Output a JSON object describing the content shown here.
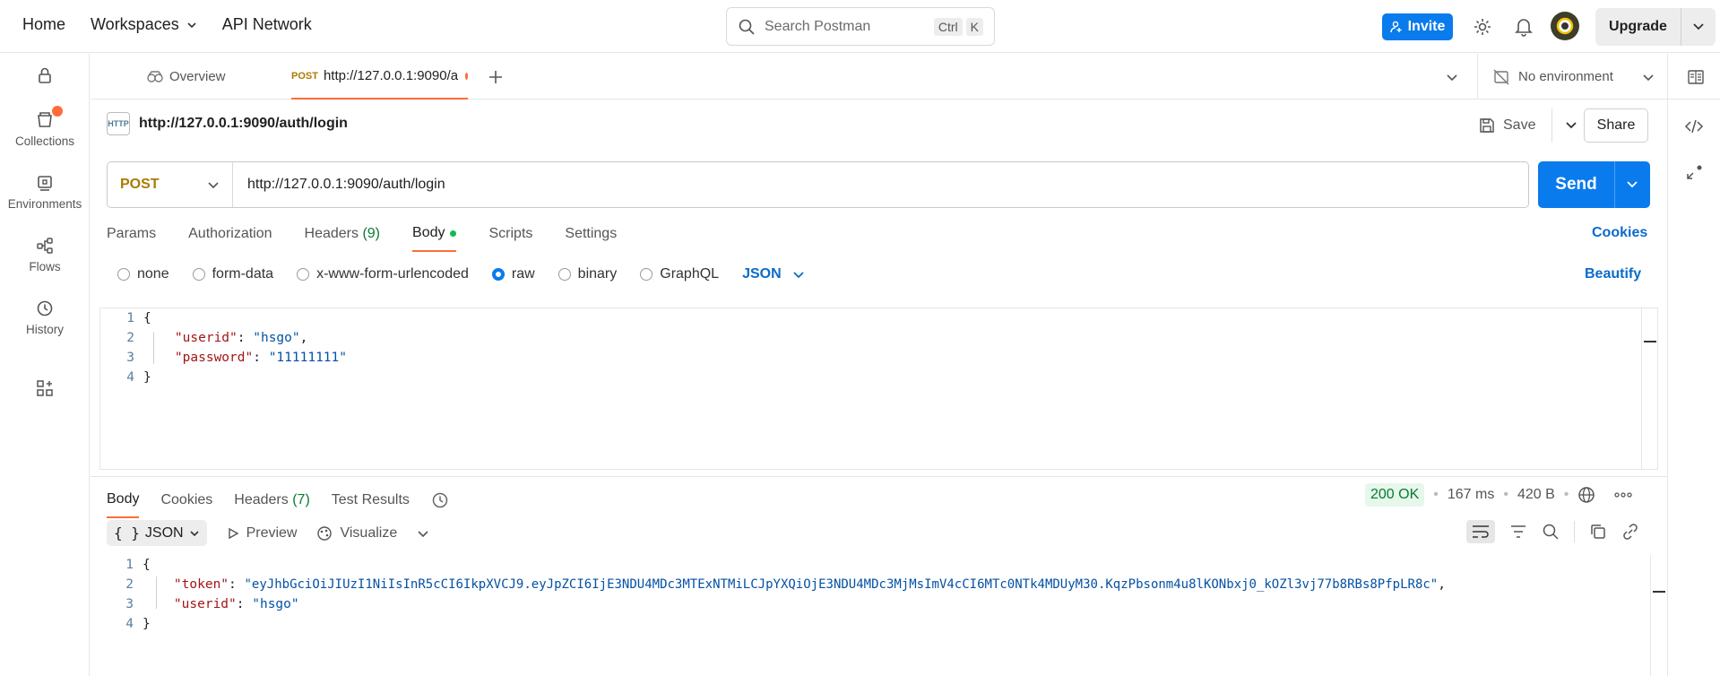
{
  "topbar": {
    "home": "Home",
    "workspaces": "Workspaces",
    "api_network": "API Network",
    "search_placeholder": "Search Postman",
    "kbd_ctrl": "Ctrl",
    "kbd_k": "K",
    "invite": "Invite",
    "upgrade": "Upgrade"
  },
  "sidebar": {
    "items": [
      {
        "label": "Collections",
        "icon": "collections-icon"
      },
      {
        "label": "Environments",
        "icon": "environments-icon"
      },
      {
        "label": "Flows",
        "icon": "flows-icon"
      },
      {
        "label": "History",
        "icon": "history-icon"
      }
    ]
  },
  "tabs": {
    "overview": "Overview",
    "active_method": "POST",
    "active_url": "http://127.0.0.1:9090/a",
    "environment": "No environment"
  },
  "request": {
    "title": "http://127.0.0.1:9090/auth/login",
    "save": "Save",
    "share": "Share",
    "method": "POST",
    "url": "http://127.0.0.1:9090/auth/login",
    "send": "Send",
    "tabs": {
      "params": "Params",
      "authorization": "Authorization",
      "headers": "Headers",
      "headers_count": "(9)",
      "body": "Body",
      "scripts": "Scripts",
      "settings": "Settings"
    },
    "cookies": "Cookies",
    "body_types": [
      "none",
      "form-data",
      "x-www-form-urlencoded",
      "raw",
      "binary",
      "GraphQL"
    ],
    "body_format": "JSON",
    "beautify": "Beautify",
    "body_lines": {
      "l1": "{",
      "l2_key": "\"userid\"",
      "l2_val": "\"hsgo\"",
      "l3_key": "\"password\"",
      "l3_val": "\"11111111\"",
      "l4": "}"
    }
  },
  "response": {
    "tabs": {
      "body": "Body",
      "cookies": "Cookies",
      "headers": "Headers",
      "headers_count": "(7)",
      "test_results": "Test Results"
    },
    "status": "200 OK",
    "time": "167 ms",
    "size": "420 B",
    "format": "JSON",
    "preview": "Preview",
    "visualize": "Visualize",
    "body_lines": {
      "l1": "{",
      "l2_key": "\"token\"",
      "l2_val": "\"eyJhbGciOiJIUzI1NiIsInR5cCI6IkpXVCJ9.eyJpZCI6IjE3NDU4MDc3MTExNTMiLCJpYXQiOjE3NDU4MDc3MjMsImV4cCI6MTc0NTk4MDUyM30.KqzPbsonm4u8lKONbxj0_kOZl3vj77b8RBs8PfpLR8c\"",
      "l3_key": "\"userid\"",
      "l3_val": "\"hsgo\"",
      "l4": "}"
    }
  },
  "colors": {
    "accent": "#ff6c37",
    "primary": "#097bed",
    "method": "#ad7a03"
  }
}
